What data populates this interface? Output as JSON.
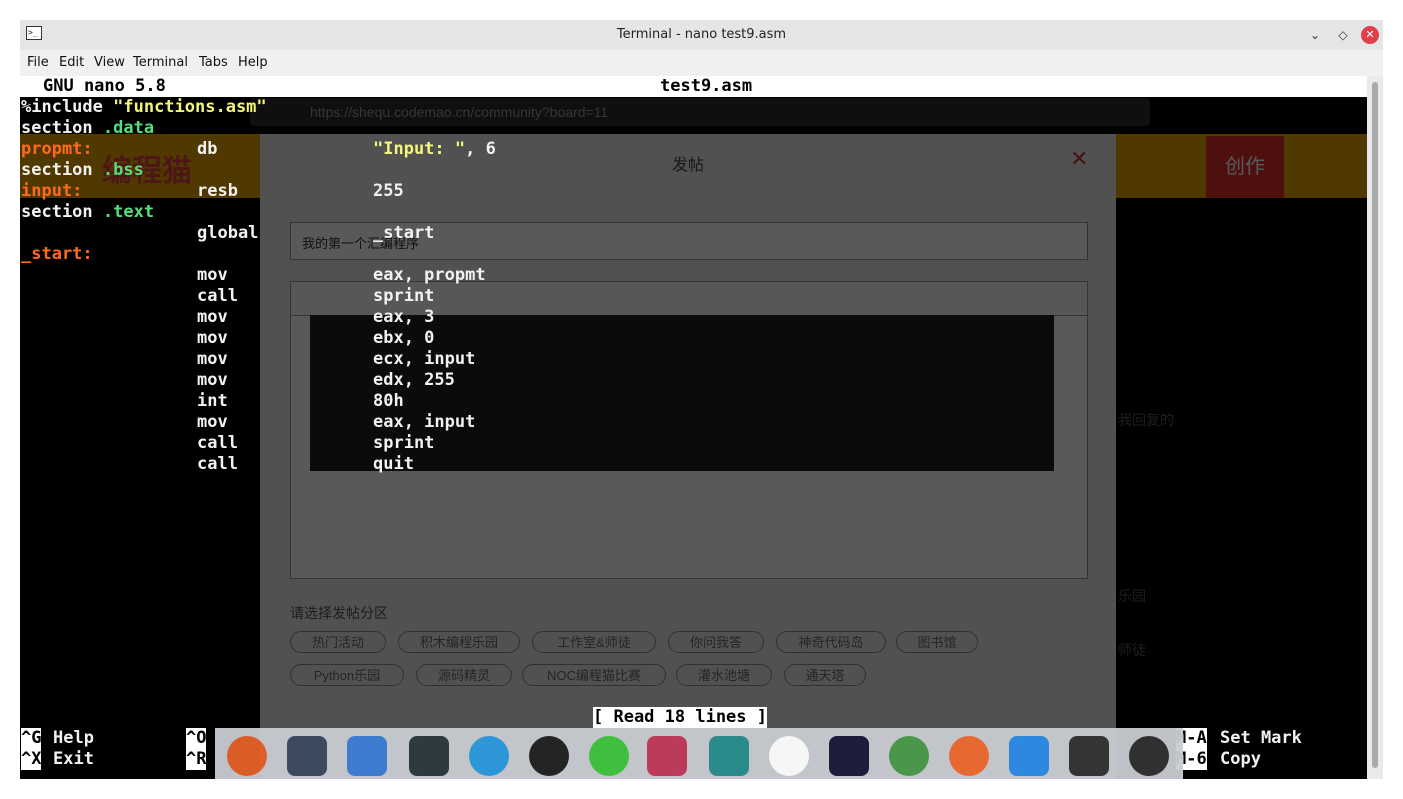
{
  "window": {
    "title": "Terminal - nano test9.asm"
  },
  "menu": [
    "File",
    "Edit",
    "View",
    "Terminal",
    "Tabs",
    "Help"
  ],
  "nano": {
    "version": "GNU nano 5.8",
    "filename": "test9.asm",
    "status": "[ Read 18 lines ]",
    "shortcuts": {
      "help_key": "^G",
      "help_label": "Help",
      "exit_key": "^X",
      "exit_label": "Exit",
      "o_key": "^O",
      "r_key": "^R",
      "setmark_key": "M-A",
      "setmark_label": "Set Mark",
      "copy_key": "M-6",
      "copy_label": "Copy"
    }
  },
  "code": {
    "line1_pre": "%include ",
    "line1_str": "\"functions.asm\"",
    "line2_a": "section ",
    "line2_b": ".data",
    "line3_lbl": "propmt:",
    "line3_op": "db",
    "line3_str": "\"Input: \"",
    "line3_rest": ", 6",
    "line4_a": "section ",
    "line4_b": ".bss",
    "line5_lbl": "input:",
    "line5_op": "resb",
    "line5_arg": "255",
    "line6_a": "section ",
    "line6_b": ".text",
    "line7_op": "global",
    "line7_arg": "_start",
    "line8_lbl": "_start:",
    "instr": [
      {
        "op": "mov",
        "arg": "eax, propmt"
      },
      {
        "op": "call",
        "arg": "sprint"
      },
      {
        "op": "mov",
        "arg": "eax, 3"
      },
      {
        "op": "mov",
        "arg": "ebx, 0"
      },
      {
        "op": "mov",
        "arg": "ecx, input"
      },
      {
        "op": "mov",
        "arg": "edx, 255"
      },
      {
        "op": "int",
        "arg": "80h"
      },
      {
        "op": "mov",
        "arg": "eax, input"
      },
      {
        "op": "call",
        "arg": "sprint"
      },
      {
        "op": "call",
        "arg": "quit"
      }
    ]
  },
  "background_browser": {
    "url": "https://shequ.codemao.cn/community?board=11",
    "logo": "编程猫",
    "create_button": "创作",
    "dialog_title": "发帖",
    "post_title": "我的第一个汇编程序",
    "section_prompt": "请选择发帖分区",
    "sections_row1": [
      "热门活动",
      "积木编程乐园",
      "工作室&师徒",
      "你问我答",
      "神奇代码岛",
      "图书馆"
    ],
    "sections_row2": [
      "Python乐园",
      "源码精灵",
      "NOC编程猫比赛",
      "灌水池塘",
      "通天塔"
    ],
    "side_reply": "我回复的",
    "side_items": [
      "乐园",
      "师徒"
    ]
  },
  "colors": {
    "terminal_bg": "#000000",
    "string": "#f5f57a",
    "keyword": "#52e07a",
    "label": "#ff6a1a",
    "titlebar": "#e3e5e7",
    "close_button": "#e0404a"
  }
}
